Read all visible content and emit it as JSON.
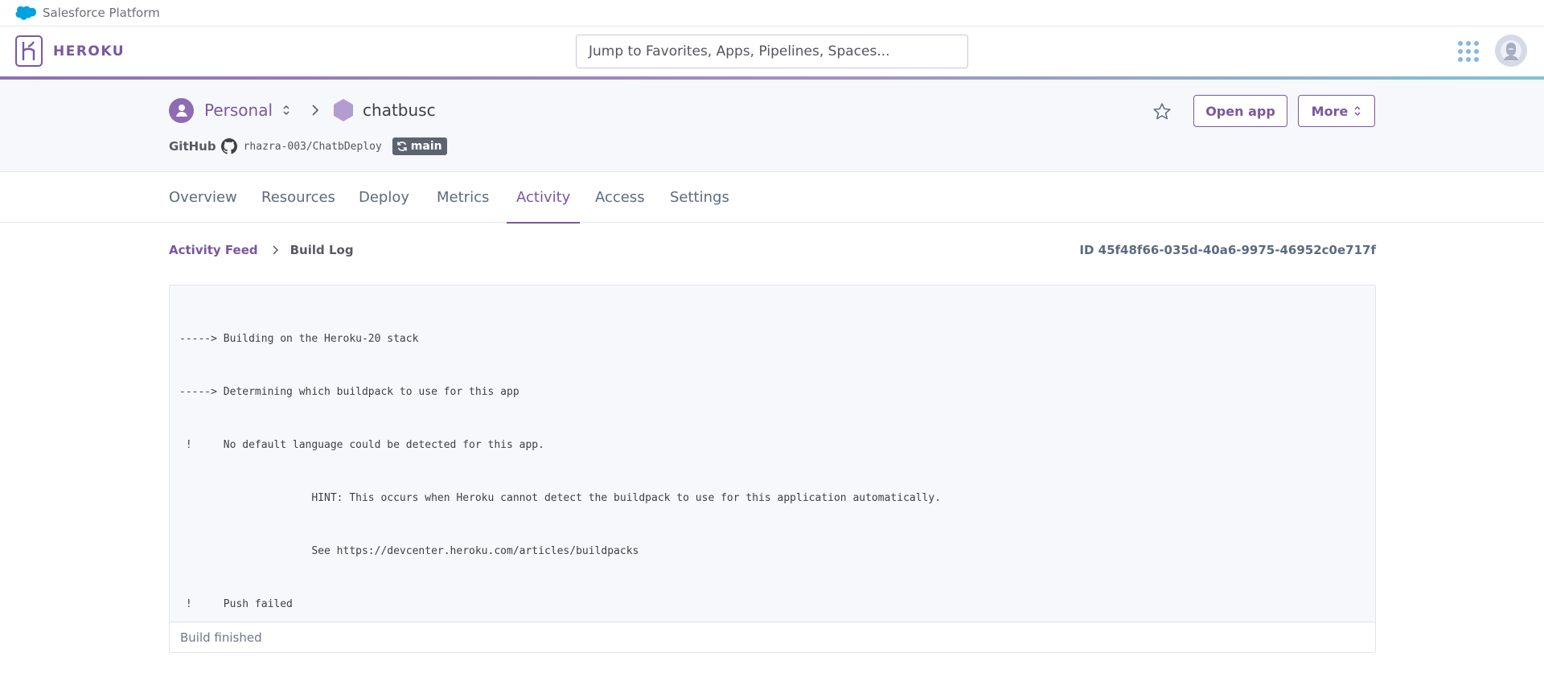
{
  "salesforce_bar": {
    "text": "Salesforce Platform"
  },
  "header": {
    "brand": "HEROKU",
    "search_placeholder": "Jump to Favorites, Apps, Pipelines, Spaces..."
  },
  "app_header": {
    "account": "Personal",
    "app_name": "chatbusc",
    "github_label": "GitHub",
    "repo": "rhazra-003/ChatbDeploy",
    "branch": "main",
    "open_app_label": "Open app",
    "more_label": "More"
  },
  "tabs": [
    {
      "label": "Overview"
    },
    {
      "label": "Resources"
    },
    {
      "label": "Deploy"
    },
    {
      "label": "Metrics"
    },
    {
      "label": "Activity",
      "active": true
    },
    {
      "label": "Access"
    },
    {
      "label": "Settings"
    }
  ],
  "content": {
    "breadcrumb_link": "Activity Feed",
    "breadcrumb_current": "Build Log",
    "build_id": "ID 45f48f66-035d-40a6-9975-46952c0e717f",
    "log_lines": [
      "-----> Building on the Heroku-20 stack",
      "-----> Determining which buildpack to use for this app",
      " !     No default language could be detected for this app.",
      "                     HINT: This occurs when Heroku cannot detect the buildpack to use for this application automatically.",
      "                     See https://devcenter.heroku.com/articles/buildpacks",
      " !     Push failed"
    ],
    "footer_status": "Build finished"
  },
  "colors": {
    "brand_purple": "#79589f",
    "salesforce_blue": "#00a1e0",
    "branch_badge": "#5d6470"
  },
  "icons": [
    "salesforce-cloud-icon",
    "heroku-logo-icon",
    "apps-grid-icon",
    "user-avatar-icon",
    "person-icon",
    "chevron-updown-icon",
    "chevron-right-icon",
    "app-hexagon-icon",
    "github-icon",
    "sync-icon",
    "star-icon"
  ]
}
